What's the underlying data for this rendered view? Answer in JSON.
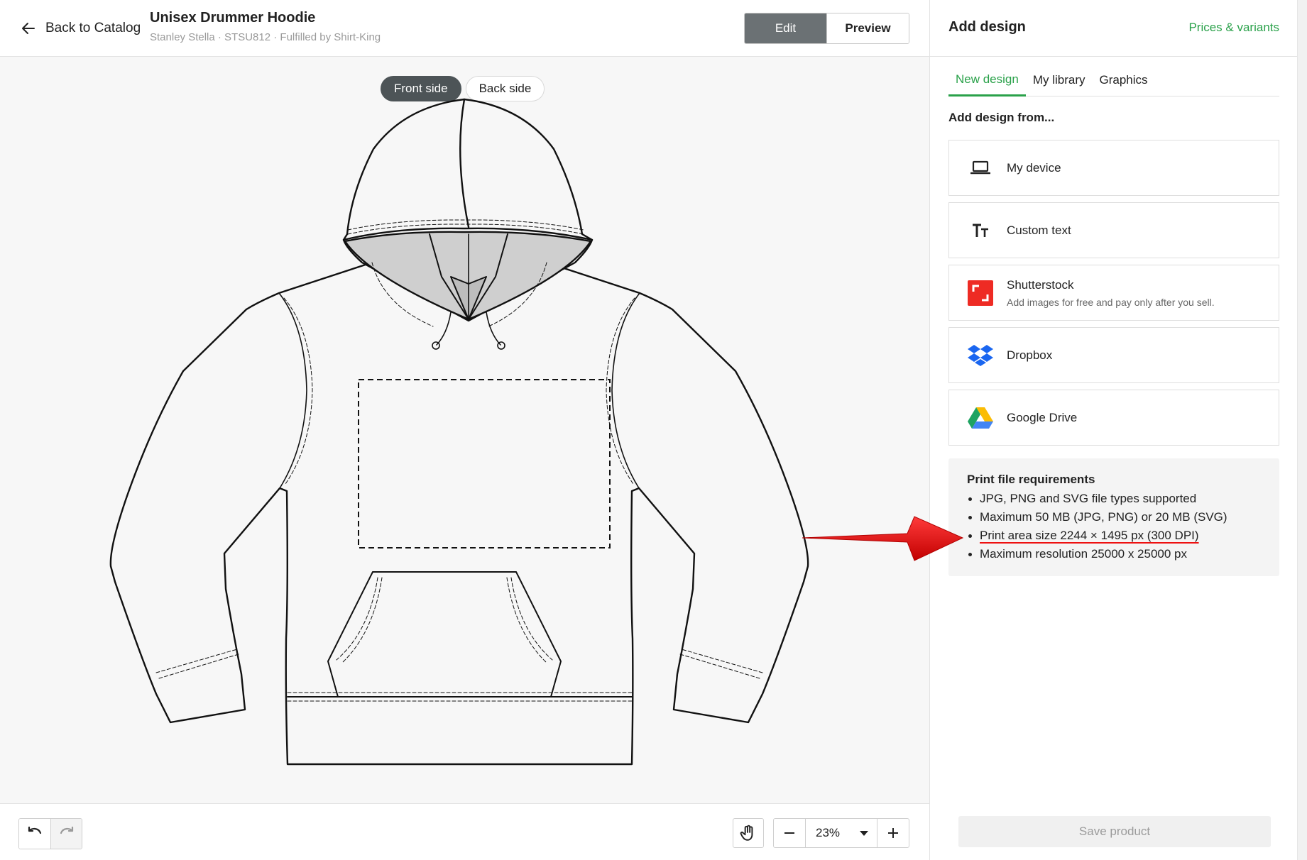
{
  "header": {
    "back_label": "Back to Catalog",
    "product_title": "Unisex Drummer Hoodie",
    "product_subtitle": "Stanley Stella · STSU812 · Fulfilled by Shirt-King",
    "edit_label": "Edit",
    "preview_label": "Preview"
  },
  "canvas": {
    "front_label": "Front side",
    "back_label": "Back side",
    "active_side": "Front side"
  },
  "bottom": {
    "zoom_value": "23%"
  },
  "panel": {
    "title": "Add design",
    "prices_link": "Prices & variants",
    "tabs": [
      {
        "label": "New design",
        "active": true
      },
      {
        "label": "My library",
        "active": false
      },
      {
        "label": "Graphics",
        "active": false
      }
    ],
    "from_label": "Add design from...",
    "sources": [
      {
        "label": "My device",
        "icon": "laptop-icon"
      },
      {
        "label": "Custom text",
        "icon": "text-icon"
      },
      {
        "label": "Shutterstock",
        "icon": "shutterstock-icon",
        "description": "Add images for free and pay only after you sell."
      },
      {
        "label": "Dropbox",
        "icon": "dropbox-icon"
      },
      {
        "label": "Google Drive",
        "icon": "google-drive-icon"
      }
    ],
    "requirements": {
      "title": "Print file requirements",
      "items": [
        "JPG, PNG and SVG file types supported",
        "Maximum 50 MB (JPG, PNG) or 20 MB (SVG)",
        "Print area size 2244 × 1495 px (300 DPI)",
        "Maximum resolution 25000 x 25000 px"
      ]
    },
    "save_label": "Save product"
  },
  "colors": {
    "accent": "#2aa14a",
    "edit_active": "#6b7174",
    "annotation": "#e11111"
  }
}
